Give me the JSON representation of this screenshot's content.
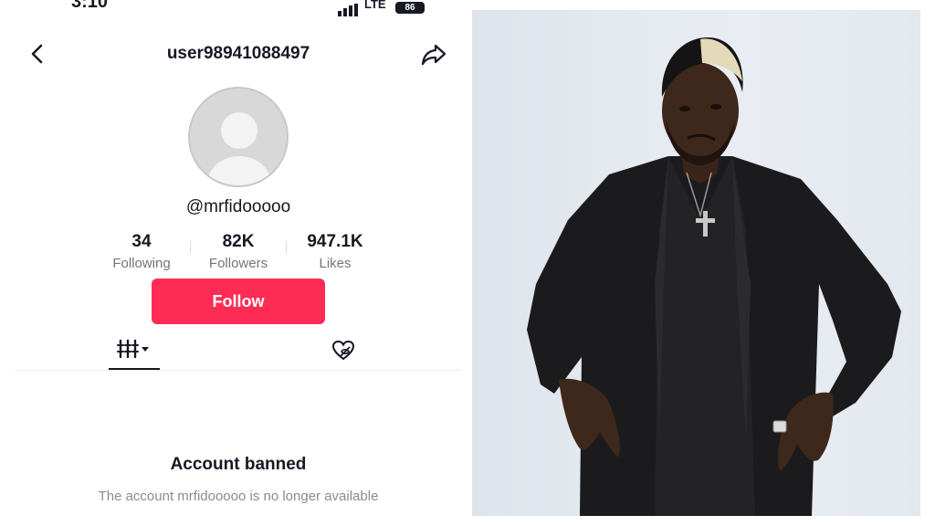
{
  "status_bar": {
    "time": "3:10",
    "network": "LTE",
    "battery": "86"
  },
  "header": {
    "username": "user98941088497",
    "back_icon": "chevron-left-icon",
    "share_icon": "share-arrow-icon"
  },
  "profile": {
    "handle": "@mrfidooooo",
    "avatar_icon": "default-avatar-icon",
    "stats": [
      {
        "value": "34",
        "label": "Following"
      },
      {
        "value": "82K",
        "label": "Followers"
      },
      {
        "value": "947.1K",
        "label": "Likes"
      }
    ],
    "follow_label": "Follow",
    "follow_color": "#fe2c55"
  },
  "tabs": {
    "videos_icon": "grid-bars-icon",
    "liked_icon": "hidden-heart-icon"
  },
  "banned": {
    "title": "Account banned",
    "message": "The account mrfidooooo is no longer available"
  },
  "photo": {
    "subject": "man-in-black-outfit-photo"
  }
}
